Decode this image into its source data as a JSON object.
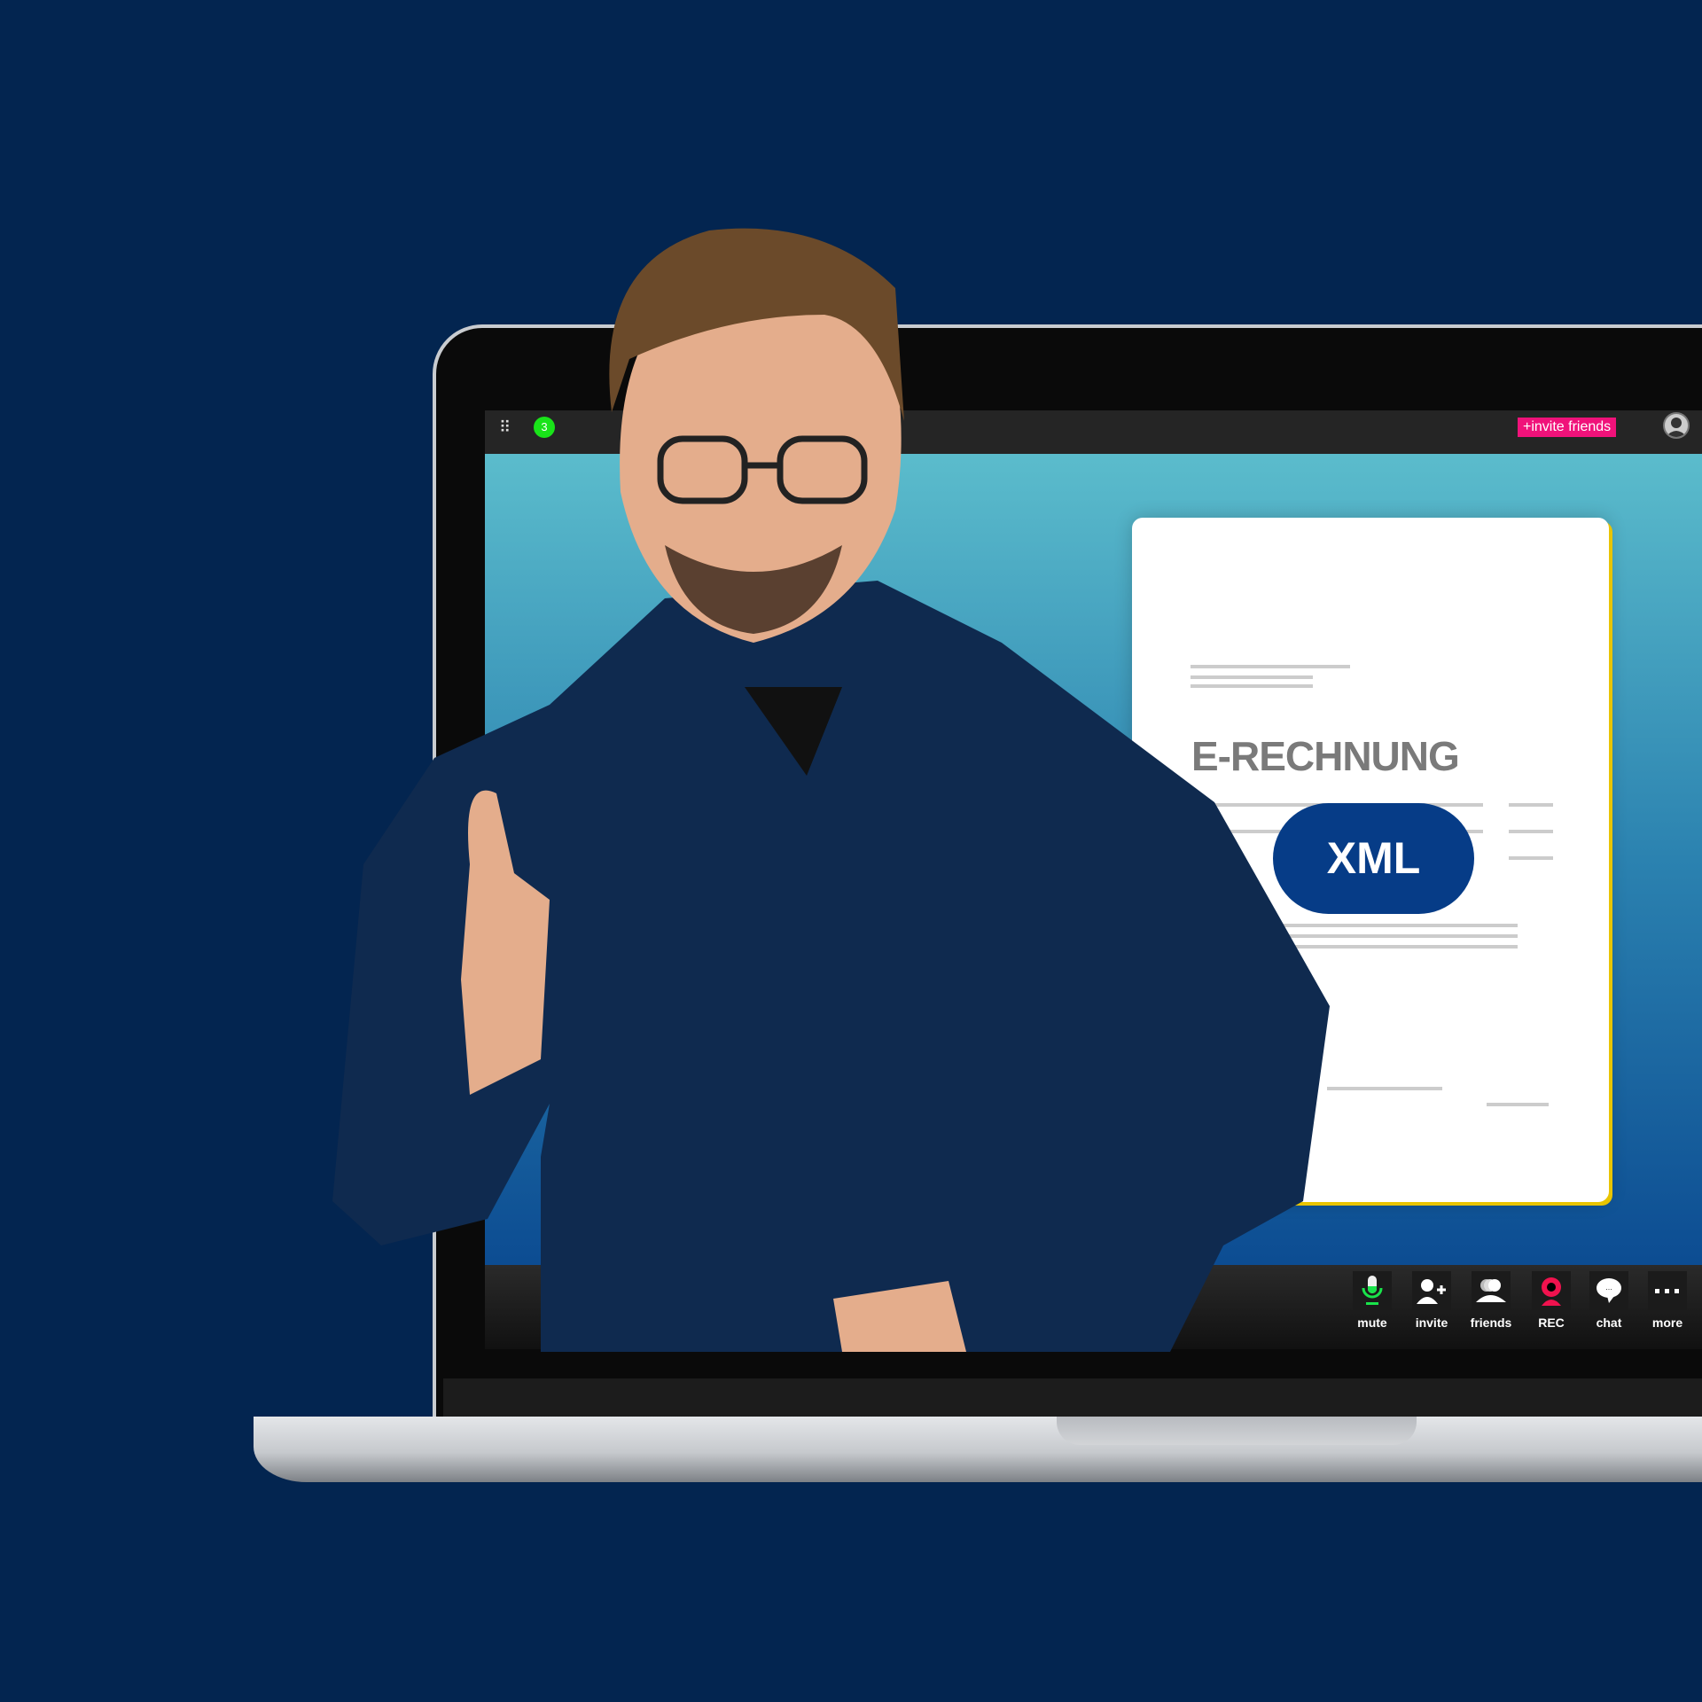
{
  "topbar": {
    "apps_icon": "grid-icon",
    "notification_count": "3",
    "invite_label": "+invite friends",
    "profile_icon": "user-icon"
  },
  "document": {
    "title": "E-RECHNUNG",
    "format_badge": "XML"
  },
  "toolbar": {
    "items": [
      {
        "label": "mute",
        "icon": "microphone-icon"
      },
      {
        "label": "invite",
        "icon": "add-user-icon"
      },
      {
        "label": "friends",
        "icon": "friends-icon"
      },
      {
        "label": "REC",
        "icon": "record-icon"
      },
      {
        "label": "chat",
        "icon": "chat-icon"
      },
      {
        "label": "more",
        "icon": "more-icon"
      }
    ]
  },
  "colors": {
    "background": "#032550",
    "invite": "#f0127a",
    "badge": "#19e319",
    "xml": "#063c87",
    "rec": "#f0124e",
    "mute": "#19e34a"
  }
}
